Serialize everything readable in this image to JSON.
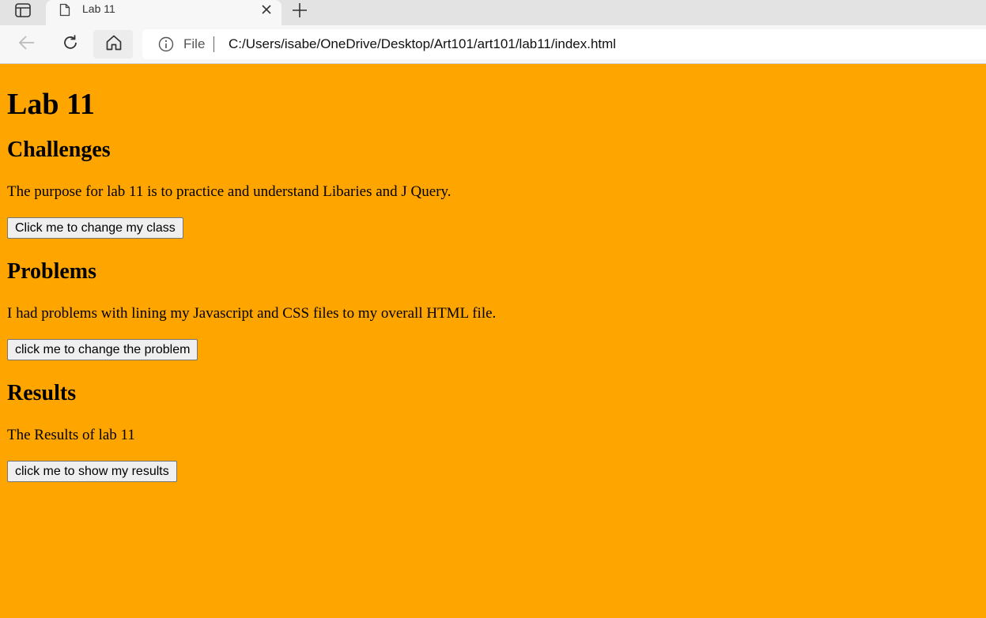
{
  "browser": {
    "tab_title": "Lab 11",
    "address_scheme_label": "File",
    "url": "C:/Users/isabe/OneDrive/Desktop/Art101/art101/lab11/index.html"
  },
  "page": {
    "title": "Lab 11",
    "sections": [
      {
        "heading": "Challenges",
        "text": "The purpose for lab 11 is to practice and understand Libaries and J Query.",
        "button_label": "Click me to change my class"
      },
      {
        "heading": "Problems",
        "text": "I had problems with lining my Javascript and CSS files to my overall HTML file.",
        "button_label": "click me to change the problem"
      },
      {
        "heading": "Results",
        "text": "The Results of lab 11",
        "button_label": "click me to show my results"
      }
    ]
  },
  "colors": {
    "page_background": "#ffa500"
  },
  "icons": {
    "sidebar": "sidebar-toggle-icon",
    "tab": "page-icon",
    "close": "close-icon",
    "new_tab": "plus-icon",
    "back": "back-arrow-icon",
    "refresh": "refresh-icon",
    "home": "home-icon",
    "info": "info-icon"
  }
}
